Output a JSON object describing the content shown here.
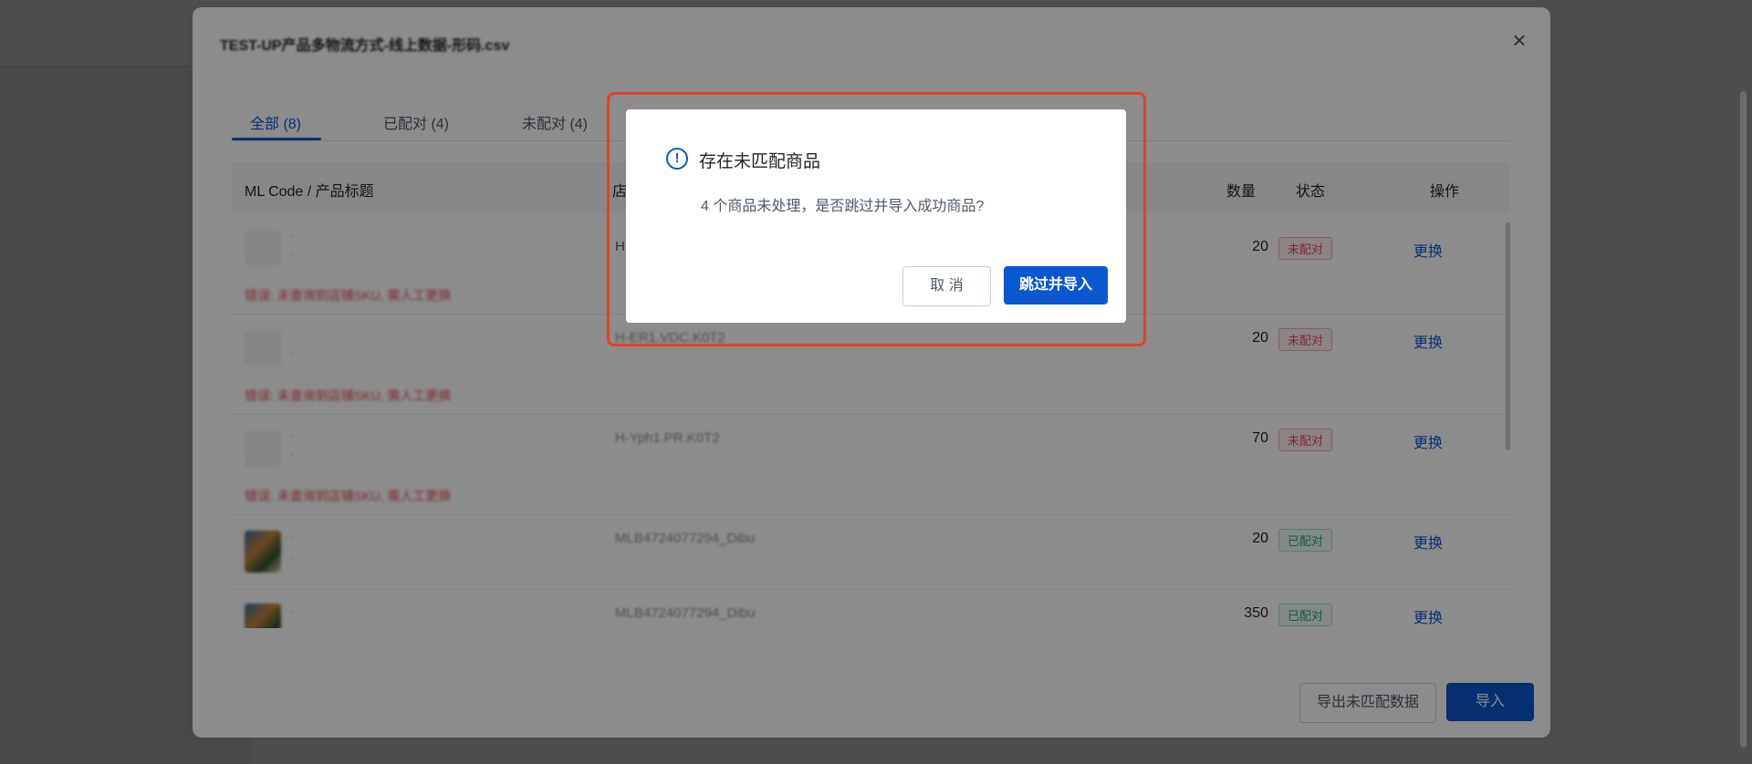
{
  "main_modal": {
    "title": "TEST-UP产品多物流方式-线上数据-形码.csv",
    "close_glyph": "×",
    "tabs": [
      {
        "label": "全部 (8)",
        "active": true
      },
      {
        "label": "已配对 (4)",
        "active": false
      },
      {
        "label": "未配对 (4)",
        "active": false
      }
    ],
    "columns": {
      "product": "ML Code / 产品标题",
      "shop": "店",
      "qty": "数量",
      "status": "状态",
      "action": "操作"
    },
    "rows": [
      {
        "sku": "H",
        "qty": "20",
        "status": "未配对",
        "action": "更换",
        "error": "错误: 未查询到店铺SKU, 需人工更换"
      },
      {
        "sku": "H-ER1.VDC.K0T2",
        "qty": "20",
        "status": "未配对",
        "action": "更换",
        "error": "错误: 未查询到店铺SKU, 需人工更换"
      },
      {
        "sku": "H-Yph1.PR.K0T2",
        "qty": "70",
        "status": "未配对",
        "action": "更换",
        "error": "错误: 未查询到店铺SKU, 需人工更换"
      },
      {
        "sku": "MLB4724077294_Dibu",
        "qty": "20",
        "status": "已配对",
        "action": "更换",
        "error": ""
      },
      {
        "sku": "MLB4724077294_Dibu",
        "qty": "350",
        "status": "已配对",
        "action": "更换",
        "error": ""
      }
    ],
    "placeholder_dash": "-",
    "export_button": "导出未匹配数据",
    "import_button": "导入"
  },
  "confirm_dialog": {
    "icon": "info-circle-icon",
    "icon_glyph": "!",
    "title": "存在未匹配商品",
    "message": "4 个商品未处理，是否跳过并导入成功商品?",
    "cancel_label": "取 消",
    "ok_label": "跳过并导入"
  },
  "colors": {
    "primary": "#0b57d0",
    "error": "#e34d59",
    "success": "#2ba471",
    "highlight": "#ea3f25"
  }
}
